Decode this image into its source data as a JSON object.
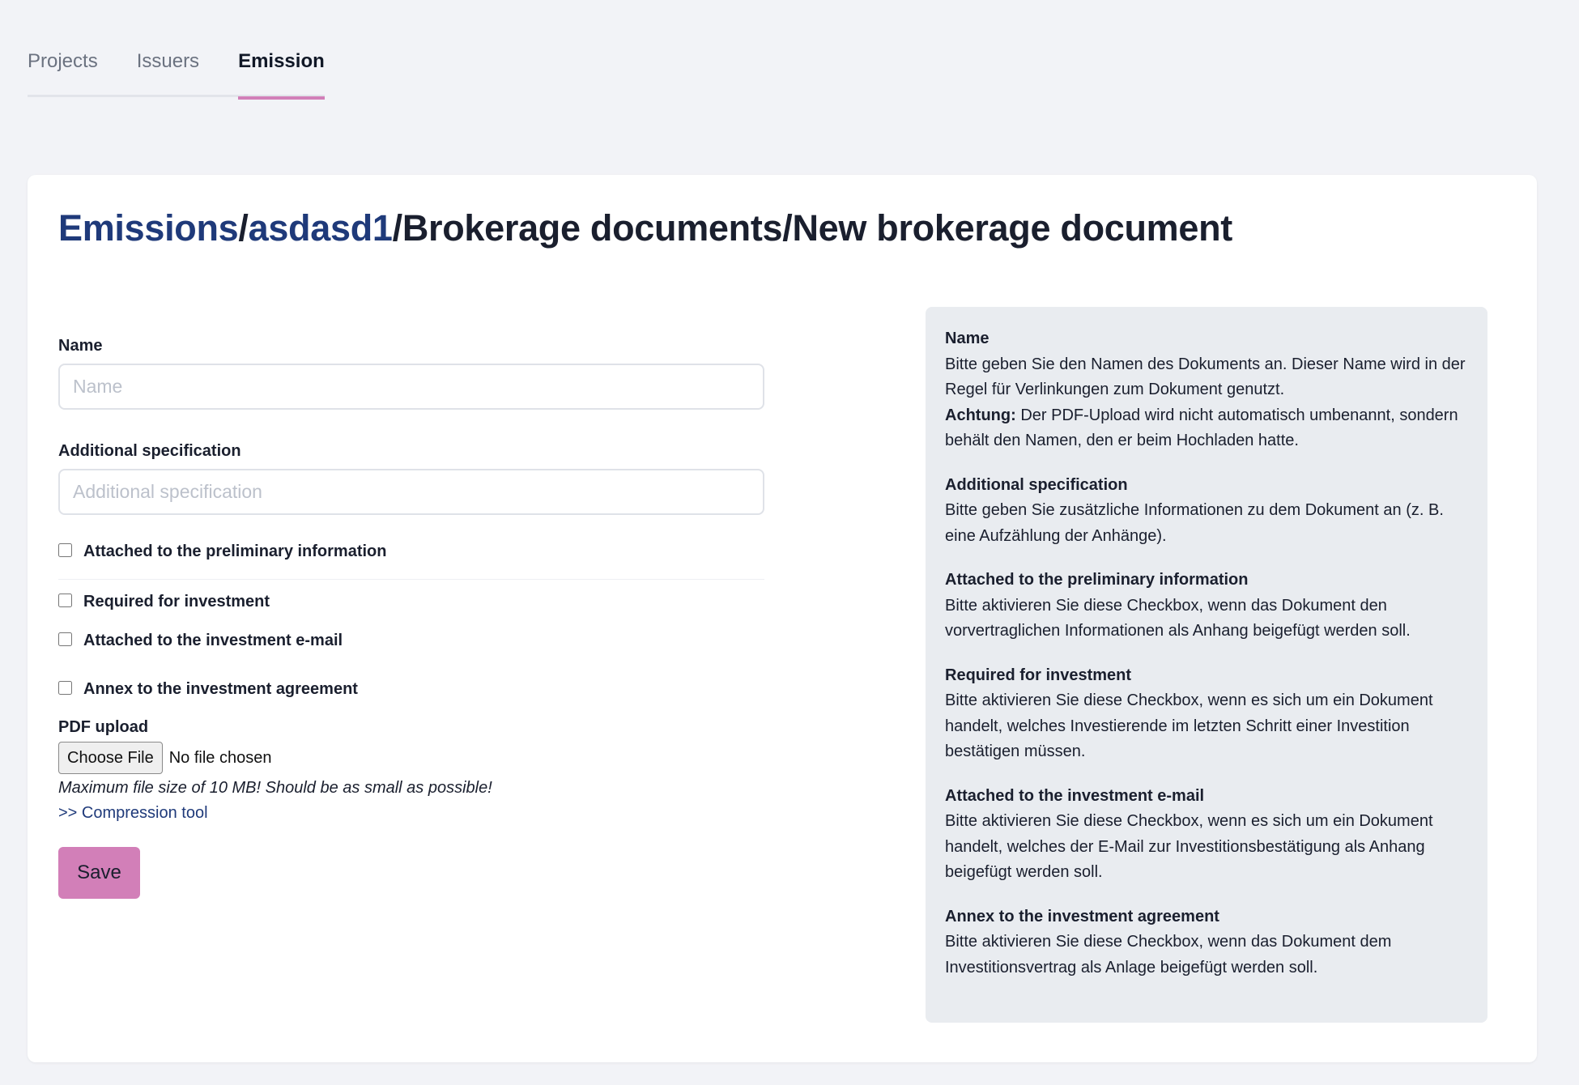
{
  "tabs": [
    {
      "label": "Projects",
      "active": false
    },
    {
      "label": "Issuers",
      "active": false
    },
    {
      "label": "Emission",
      "active": true
    }
  ],
  "breadcrumb": {
    "emissions": "Emissions",
    "sep": "/",
    "emission": "asdasd1",
    "section": "Brokerage documents",
    "page": "New brokerage document"
  },
  "form": {
    "name_label": "Name",
    "name_placeholder": "Name",
    "name_value": "",
    "spec_label": "Additional specification",
    "spec_placeholder": "Additional specification",
    "spec_value": "",
    "checkboxes": [
      {
        "label": "Attached to the preliminary information",
        "checked": false
      },
      {
        "label": "Required for investment",
        "checked": false
      },
      {
        "label": "Attached to the investment e-mail",
        "checked": false
      },
      {
        "label": "Annex to the investment agreement",
        "checked": false
      }
    ],
    "pdf_label": "PDF upload",
    "choose_file": "Choose File",
    "no_file": "No file chosen",
    "size_hint": "Maximum file size of 10 MB! Should be as small as possible!",
    "compression_link": ">> Compression tool",
    "save": "Save"
  },
  "help": {
    "name_title": "Name",
    "name_text": "Bitte geben Sie den Namen des Dokuments an. Dieser Name wird in der Regel für Verlinkungen zum Dokument genutzt.",
    "name_warning_label": "Achtung:",
    "name_warning_text": "Der PDF-Upload wird nicht automatisch umbenannt, sondern behält den Namen, den er beim Hochladen hatte.",
    "spec_title": "Additional specification",
    "spec_text": "Bitte geben Sie zusätzliche Informationen zu dem Dokument an (z. B. eine Aufzählung der Anhänge).",
    "prelim_title": "Attached to the preliminary information",
    "prelim_text": "Bitte aktivieren Sie diese Checkbox, wenn das Dokument den vorvertraglichen Informationen als Anhang beigefügt werden soll.",
    "required_title": "Required for investment",
    "required_text": "Bitte aktivieren Sie diese Checkbox, wenn es sich um ein Dokument handelt, welches Investierende im letzten Schritt einer Investition bestätigen müssen.",
    "email_title": "Attached to the investment e-mail",
    "email_text": "Bitte aktivieren Sie diese Checkbox, wenn es sich um ein Dokument handelt, welches der E-Mail zur Investitionsbestätigung als Anhang beigefügt werden soll.",
    "annex_title": "Annex to the investment agreement",
    "annex_text": "Bitte aktivieren Sie diese Checkbox, wenn das Dokument dem Investitionsvertrag als Anlage beigefügt werden soll."
  },
  "colors": {
    "accent": "#d27fb8",
    "link": "#1f3a7a",
    "background": "#f2f3f7",
    "help_panel": "#e9ecf0"
  }
}
